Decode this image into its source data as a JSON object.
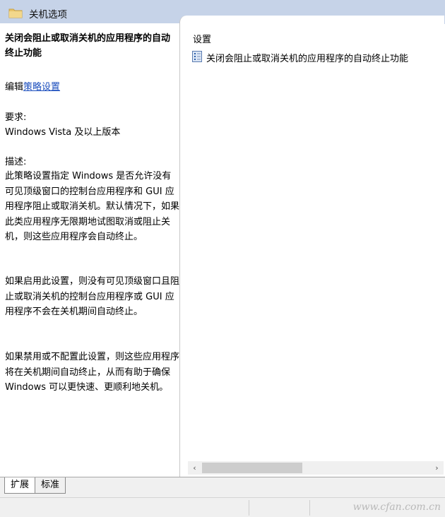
{
  "header": {
    "title": "关机选项"
  },
  "left_pane": {
    "policy_title": "关闭会阻止或取消关机的应用程序的自动终止功能",
    "edit_prefix": "编辑",
    "edit_link": "策略设置",
    "requirements_label": "要求:",
    "requirements_value": "Windows Vista 及以上版本",
    "description_label": "描述:",
    "paragraphs": [
      "此策略设置指定 Windows 是否允许没有可见顶级窗口的控制台应用程序和 GUI 应用程序阻止或取消关机。默认情况下，如果此类应用程序无限期地试图取消或阻止关机，则这些应用程序会自动终止。",
      "如果启用此设置，则没有可见顶级窗口且阻止或取消关机的控制台应用程序或 GUI 应用程序不会在关机期间自动终止。",
      "如果禁用或不配置此设置，则这些应用程序将在关机期间自动终止，从而有助于确保 Windows 可以更快速、更顺利地关机。"
    ]
  },
  "right_pane": {
    "settings_header": "设置",
    "items": [
      {
        "label": "关闭会阻止或取消关机的应用程序的自动终止功能"
      }
    ]
  },
  "scrollbar": {
    "left_arrow": "‹",
    "right_arrow": "›"
  },
  "tabs": [
    {
      "label": "扩展"
    },
    {
      "label": "标准"
    }
  ],
  "watermark": "www.cfan.com.cn",
  "colors": {
    "header_bg": "#c6d3e8",
    "link": "#1a4dbd",
    "folder": "#e8c36a"
  }
}
